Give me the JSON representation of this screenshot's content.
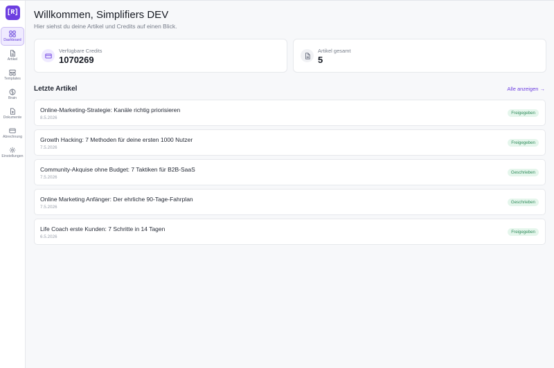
{
  "brand": {
    "logo_text": "[R]",
    "accent_color": "#6d3fe0"
  },
  "sidebar": {
    "items": [
      {
        "label": "Dashboard",
        "icon": "grid-icon",
        "active": true
      },
      {
        "label": "Artikel",
        "icon": "document-icon",
        "active": false
      },
      {
        "label": "Templates",
        "icon": "template-icon",
        "active": false
      },
      {
        "label": "Brain",
        "icon": "brain-icon",
        "active": false
      },
      {
        "label": "Dokumente",
        "icon": "file-upload-icon",
        "active": false
      },
      {
        "label": "Abrechnung",
        "icon": "credit-card-icon",
        "active": false
      },
      {
        "label": "Einstellungen",
        "icon": "gear-icon",
        "active": false
      }
    ]
  },
  "header": {
    "title": "Willkommen, Simplifiers DEV",
    "subtitle": "Hier siehst du deine Artikel und Credits auf einen Blick."
  },
  "stats": {
    "credits": {
      "label": "Verfügbare Credits",
      "value": "1070269",
      "icon": "credit-card-icon"
    },
    "articles": {
      "label": "Artikel gesamt",
      "value": "5",
      "icon": "document-icon"
    }
  },
  "recent": {
    "title": "Letzte Artikel",
    "show_all": "Alle anzeigen →",
    "items": [
      {
        "title": "Online-Marketing-Strategie: Kanäle richtig priorisieren",
        "date": "8.5.2026",
        "status": "Freigegeben"
      },
      {
        "title": "Growth Hacking: 7 Methoden für deine ersten 1000 Nutzer",
        "date": "7.5.2026",
        "status": "Freigegeben"
      },
      {
        "title": "Community-Akquise ohne Budget: 7 Taktiken für B2B-SaaS",
        "date": "7.5.2026",
        "status": "Geschrieben"
      },
      {
        "title": "Online Marketing Anfänger: Der ehrliche 90-Tage-Fahrplan",
        "date": "7.5.2026",
        "status": "Geschrieben"
      },
      {
        "title": "Life Coach erste Kunden: 7 Schritte in 14 Tagen",
        "date": "6.5.2026",
        "status": "Freigegeben"
      }
    ]
  },
  "status_colors": {
    "badge_bg": "#e5f6ec",
    "badge_text": "#2f8a5a"
  }
}
